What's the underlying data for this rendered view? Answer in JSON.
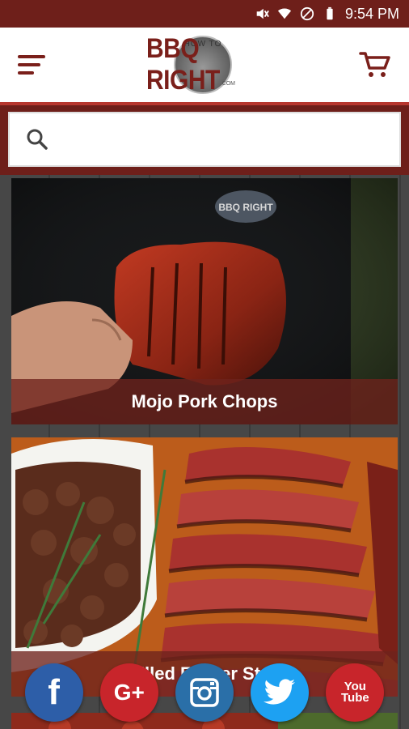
{
  "status_bar": {
    "time": "9:54 PM",
    "icons": [
      "mute-icon",
      "wifi-icon",
      "do-not-disturb-icon",
      "battery-icon"
    ]
  },
  "header": {
    "logo_top": "HOW TO",
    "logo_main": "BBQ RIGHT",
    "logo_suffix": ".COM",
    "menu_icon": "hamburger-menu-icon",
    "cart_icon": "shopping-cart-icon"
  },
  "search": {
    "placeholder": "",
    "value": "",
    "icon": "search-icon"
  },
  "colors": {
    "brand": "#7a1f1a",
    "brand_dark": "#6e1f1a",
    "accent": "#b7362e"
  },
  "recipes": [
    {
      "title": "Mojo Pork Chops"
    },
    {
      "title": "Grilled Flower Steak"
    },
    {
      "title": ""
    }
  ],
  "social": [
    {
      "name": "facebook",
      "label": "f"
    },
    {
      "name": "google-plus",
      "label": "G+"
    },
    {
      "name": "instagram",
      "label": ""
    },
    {
      "name": "twitter",
      "label": ""
    },
    {
      "name": "youtube",
      "label": "You Tube"
    }
  ]
}
